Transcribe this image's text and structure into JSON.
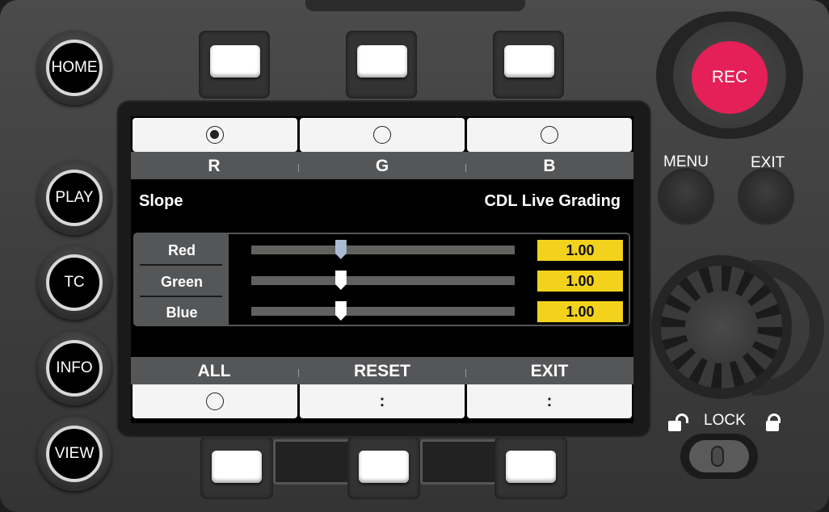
{
  "left_buttons": [
    "HOME",
    "PLAY",
    "TC",
    "INFO",
    "VIEW"
  ],
  "rec_label": "REC",
  "menu_label": "MENU",
  "exit_label": "EXIT",
  "lock_label": "LOCK",
  "screen": {
    "top_tabs": [
      {
        "label": "R",
        "selected": true
      },
      {
        "label": "G",
        "selected": false
      },
      {
        "label": "B",
        "selected": false
      }
    ],
    "param_title": "Slope",
    "mode_title": "CDL Live Grading",
    "sliders": [
      {
        "label": "Red",
        "value": "1.00",
        "level": 0.34,
        "active": true
      },
      {
        "label": "Green",
        "value": "1.00",
        "level": 0.34,
        "active": false
      },
      {
        "label": "Blue",
        "value": "1.00",
        "level": 0.34,
        "active": false
      }
    ],
    "bottom_tabs": [
      {
        "label": "ALL",
        "indicator": "circle"
      },
      {
        "label": "RESET",
        "indicator": ":"
      },
      {
        "label": "EXIT",
        "indicator": ":"
      }
    ]
  },
  "colors": {
    "rec": "#e51f57",
    "value_bg": "#f2d21c",
    "tab_bar": "#555658"
  }
}
